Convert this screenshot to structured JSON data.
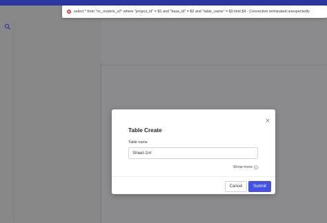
{
  "toast": {
    "icon": "error-icon",
    "message": "select * from \"nc_models_v2\" where \"project_id\" = $1 and \"base_id\" = $2 and \"table_name\" = $3 limit $4 - Connection terminated unexpectedly",
    "color": "#e5494d"
  },
  "sidebar": {
    "search_icon": "search-icon"
  },
  "modal": {
    "title": "Table Create",
    "close_icon": "close-icon",
    "field_label": "Table name",
    "field_value": "Sheet-1rrr",
    "show_more": "Show more",
    "show_more_icon": "chevron-down-circle-icon",
    "cancel_label": "Cancel",
    "submit_label": "Submit",
    "accent": "#4351e8"
  },
  "colors": {
    "topbar": "#2d36a0",
    "overlay": "#8b8b8e"
  }
}
